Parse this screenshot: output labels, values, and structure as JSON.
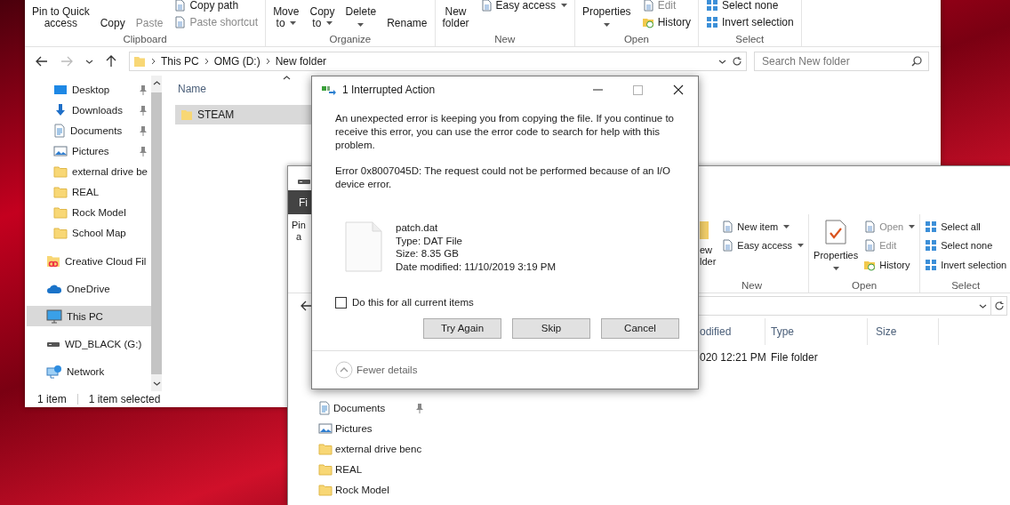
{
  "back_window": {
    "ribbon_groups": [
      {
        "label": "Clipboard",
        "items": [
          {
            "kind": "large",
            "lines": [
              "Pin to Quick",
              "access"
            ],
            "dropdown": false,
            "disabled": false
          },
          {
            "kind": "large",
            "lines": [
              "Copy"
            ],
            "dropdown": false,
            "disabled": false
          },
          {
            "kind": "large",
            "lines": [
              "Paste"
            ],
            "dropdown": false,
            "disabled": true
          },
          {
            "kind": "stack",
            "rows": [
              {
                "kind": "page",
                "label": "Copy path",
                "dropdown": false,
                "disabled": false
              },
              {
                "kind": "page",
                "label": "Paste shortcut",
                "dropdown": false,
                "disabled": true
              }
            ]
          }
        ]
      },
      {
        "label": "Organize",
        "items": [
          {
            "kind": "large",
            "lines": [
              "Move",
              "to"
            ],
            "dropdown": true,
            "disabled": false
          },
          {
            "kind": "large",
            "lines": [
              "Copy",
              "to"
            ],
            "dropdown": true,
            "disabled": false
          },
          {
            "kind": "large",
            "lines": [
              "Delete"
            ],
            "dropdown": true,
            "disabled": false
          },
          {
            "kind": "large",
            "lines": [
              "Rename"
            ],
            "dropdown": false,
            "disabled": false
          }
        ]
      },
      {
        "label": "New",
        "items": [
          {
            "kind": "large",
            "lines": [
              "New",
              "folder"
            ],
            "dropdown": false,
            "disabled": false
          },
          {
            "kind": "stack",
            "rows": [
              {
                "kind": "page",
                "label": "Easy access",
                "dropdown": true,
                "disabled": false
              }
            ]
          }
        ]
      },
      {
        "label": "Open",
        "items": [
          {
            "kind": "large",
            "lines": [
              "Properties"
            ],
            "dropdown": true,
            "disabled": false
          },
          {
            "kind": "stack",
            "rows": [
              {
                "kind": "page",
                "label": "Edit",
                "dropdown": false,
                "disabled": true
              },
              {
                "kind": "history",
                "label": "History",
                "dropdown": false,
                "disabled": false
              }
            ]
          }
        ]
      },
      {
        "label": "Select",
        "items": [
          {
            "kind": "stack",
            "rows": [
              {
                "kind": "grid",
                "label": "Select none",
                "dropdown": false,
                "disabled": false
              },
              {
                "kind": "grid",
                "label": "Invert selection",
                "dropdown": false,
                "disabled": false
              }
            ]
          }
        ]
      }
    ],
    "address": {
      "path": [
        "This PC",
        "OMG (D:)",
        "New folder"
      ]
    },
    "search": {
      "placeholder": "Search New folder"
    },
    "nav_sections": [
      {
        "kind": "quick-access",
        "items": [
          {
            "kind": "desktop",
            "label": "Desktop",
            "pinned": true,
            "selected": false
          },
          {
            "kind": "downloads",
            "label": "Downloads",
            "pinned": true,
            "selected": false
          },
          {
            "kind": "documents",
            "label": "Documents",
            "pinned": true,
            "selected": false
          },
          {
            "kind": "pictures",
            "label": "Pictures",
            "pinned": true,
            "selected": false
          },
          {
            "kind": "folder",
            "label": "external drive be",
            "pinned": false,
            "selected": false
          },
          {
            "kind": "folder",
            "label": "REAL",
            "pinned": false,
            "selected": false
          },
          {
            "kind": "folder",
            "label": "Rock Model",
            "pinned": false,
            "selected": false
          },
          {
            "kind": "folder",
            "label": "School Map",
            "pinned": false,
            "selected": false
          }
        ]
      },
      {
        "kind": "locations",
        "items": [
          {
            "kind": "creative-cloud",
            "label": "Creative Cloud Fil",
            "pinned": false,
            "selected": false
          },
          {
            "kind": "onedrive",
            "label": "OneDrive",
            "pinned": false,
            "selected": false
          },
          {
            "kind": "pc",
            "label": "This PC",
            "pinned": false,
            "selected": true
          },
          {
            "kind": "drive",
            "label": "WD_BLACK (G:)",
            "pinned": false,
            "selected": false
          },
          {
            "kind": "network",
            "label": "Network",
            "pinned": false,
            "selected": false
          }
        ]
      }
    ],
    "columns": [
      {
        "label": "Name",
        "sorted": true
      }
    ],
    "rows": [
      {
        "kind": "folder",
        "cells": [
          "STEAM"
        ],
        "selected": true
      }
    ],
    "status_bar": [
      "1 item",
      "1 item selected"
    ]
  },
  "front_window": {
    "file_tab": "Fi",
    "ribbon_groups": [
      {
        "items": [
          {
            "kind": "large",
            "lines": [
              "Pin",
              "a"
            ],
            "dropdown": false,
            "disabled": false
          }
        ]
      },
      {
        "label": "New",
        "items": [
          {
            "kind": "large-folder",
            "lines": [
              "ew",
              "lder"
            ],
            "dropdown": false,
            "disabled": false
          },
          {
            "kind": "stack",
            "rows": [
              {
                "kind": "page",
                "label": "New item",
                "dropdown": true,
                "disabled": false
              },
              {
                "kind": "page",
                "label": "Easy access",
                "dropdown": true,
                "disabled": false
              }
            ]
          }
        ]
      },
      {
        "label": "Open",
        "items": [
          {
            "kind": "large-properties",
            "lines": [
              "Properties"
            ],
            "dropdown": true,
            "disabled": false
          },
          {
            "kind": "stack",
            "rows": [
              {
                "kind": "page",
                "label": "Open",
                "dropdown": true,
                "disabled": true
              },
              {
                "kind": "page",
                "label": "Edit",
                "dropdown": false,
                "disabled": true
              },
              {
                "kind": "history",
                "label": "History",
                "dropdown": false,
                "disabled": false
              }
            ]
          }
        ]
      },
      {
        "label": "Select",
        "items": [
          {
            "kind": "stack",
            "rows": [
              {
                "kind": "grid",
                "label": "Select all",
                "dropdown": false,
                "disabled": false
              },
              {
                "kind": "grid",
                "label": "Select none",
                "dropdown": false,
                "disabled": false
              },
              {
                "kind": "grid",
                "label": "Invert selection",
                "dropdown": false,
                "disabled": false
              }
            ]
          }
        ]
      }
    ],
    "nav_sections": [
      {
        "kind": "quick-access",
        "items": [
          {
            "kind": "documents",
            "label": "Documents",
            "pinned": true,
            "selected": false
          },
          {
            "kind": "pictures",
            "label": "Pictures",
            "pinned": false,
            "selected": false
          },
          {
            "kind": "folder",
            "label": "external drive benc",
            "pinned": false,
            "selected": false
          },
          {
            "kind": "folder",
            "label": "REAL",
            "pinned": false,
            "selected": false
          },
          {
            "kind": "folder",
            "label": "Rock Model",
            "pinned": false,
            "selected": false
          }
        ]
      }
    ],
    "columns": [
      {
        "label": "odified",
        "sorted": false
      },
      {
        "label": "Type",
        "sorted": false
      },
      {
        "label": "Size",
        "sorted": false
      }
    ],
    "rows": [
      {
        "cells": [
          "020 12:21 PM",
          "File folder"
        ],
        "selected": false
      }
    ]
  },
  "dialog": {
    "title": "1 Interrupted Action",
    "controls": [
      {
        "kind": "minimize",
        "disabled": false
      },
      {
        "kind": "maximize",
        "disabled": true
      },
      {
        "kind": "close",
        "disabled": false
      }
    ],
    "message": "An unexpected error is keeping you from copying the file. If you continue to receive this error, you can use the error code to search for help with this problem.",
    "error": "Error 0x8007045D: The request could not be performed because of an I/O device error.",
    "file": {
      "name": "patch.dat",
      "type": "Type: DAT File",
      "size": "Size: 8.35 GB",
      "modified": "Date modified: 11/10/2019 3:19 PM"
    },
    "checkbox": {
      "label": "Do this for all current items",
      "checked": false
    },
    "buttons": [
      "Try Again",
      "Skip",
      "Cancel"
    ],
    "details_toggle": {
      "label": "Fewer details",
      "expanded": true
    }
  }
}
